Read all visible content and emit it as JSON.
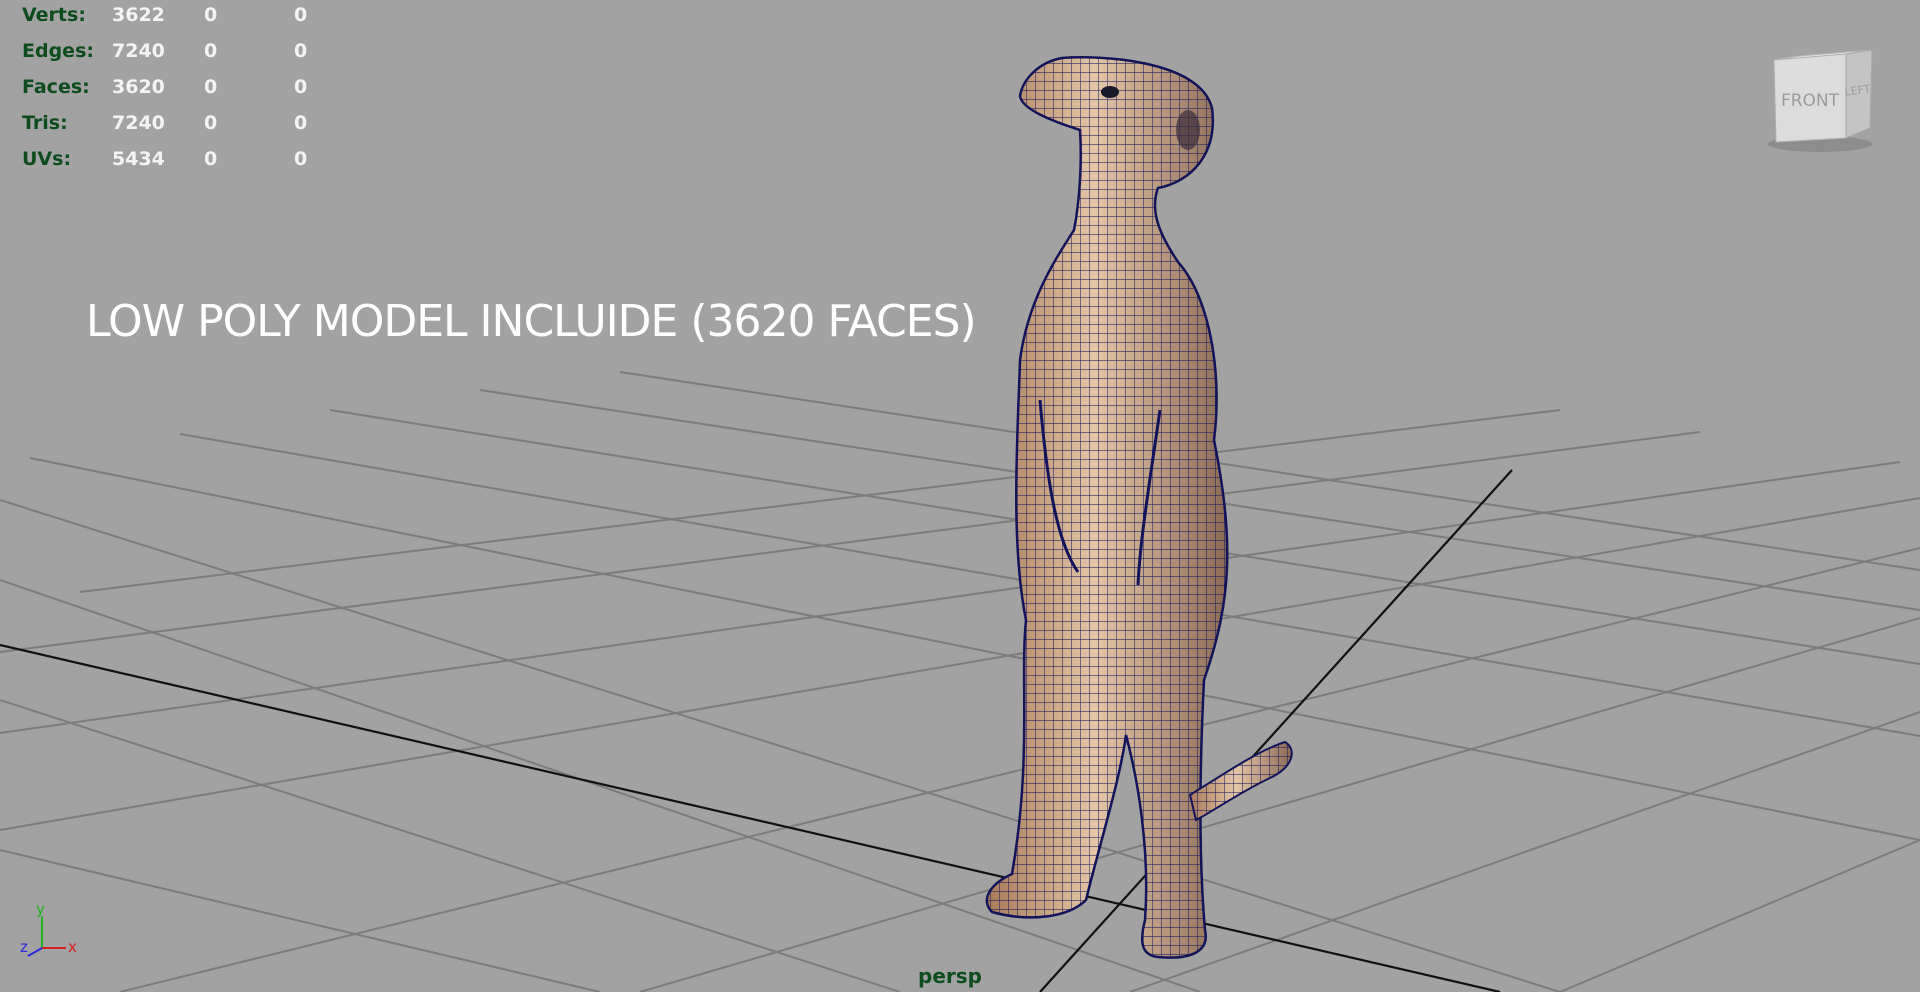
{
  "heads_up_display": {
    "rows": [
      {
        "label": "Verts:",
        "total": "3622",
        "selected": "0",
        "component": "0"
      },
      {
        "label": "Edges:",
        "total": "7240",
        "selected": "0",
        "component": "0"
      },
      {
        "label": "Faces:",
        "total": "3620",
        "selected": "0",
        "component": "0"
      },
      {
        "label": "Tris:",
        "total": "7240",
        "selected": "0",
        "component": "0"
      },
      {
        "label": "UVs:",
        "total": "5434",
        "selected": "0",
        "component": "0"
      }
    ]
  },
  "overlay_caption": "LOW POLY MODEL INCLUIDE (3620 FACES)",
  "camera": {
    "name": "persp"
  },
  "view_cube": {
    "front_label": "FRONT",
    "side_label": "LEFT"
  },
  "axis_gizmo": {
    "x": "x",
    "y": "y",
    "z": "z"
  },
  "colors": {
    "viewport_bg": "#a2a2a2",
    "grid": "#7a7a7a",
    "grid_axis": "#111111",
    "hud_label": "#0d4d1d",
    "wireframe": "#13135c",
    "fur": "#c8a07a"
  }
}
